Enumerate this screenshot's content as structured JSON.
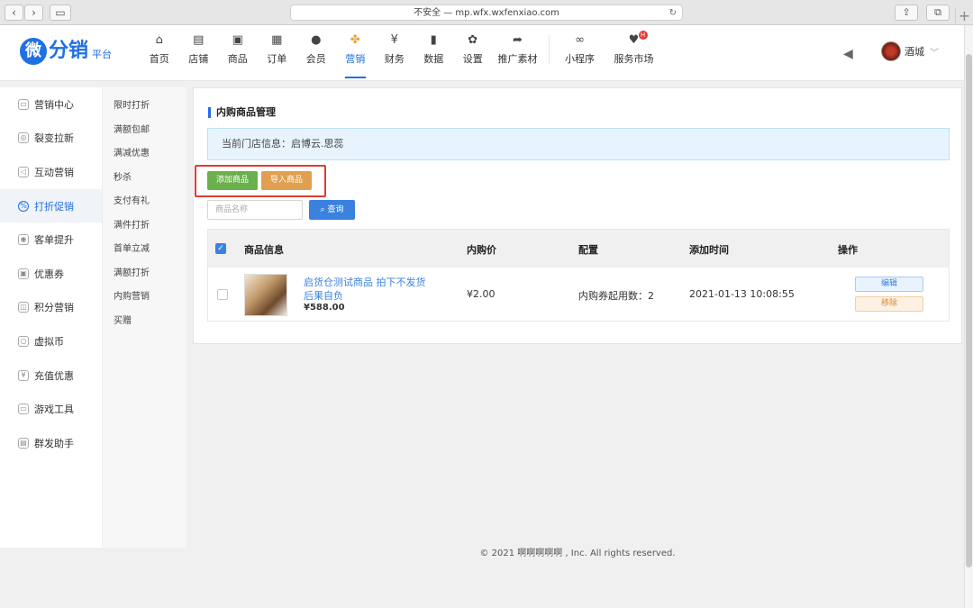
{
  "browser": {
    "url": "不安全 — mp.wfx.wxfenxiao.com",
    "back_icon": "‹",
    "forward_icon": "›",
    "reload_icon": "↻",
    "new_tab": "+"
  },
  "logo": {
    "mark": "微",
    "text": "分销",
    "sub": "平台"
  },
  "nav": [
    {
      "label": "首页",
      "icon": "⌂"
    },
    {
      "label": "店铺",
      "icon": "▤"
    },
    {
      "label": "商品",
      "icon": "▣"
    },
    {
      "label": "订单",
      "icon": "▦"
    },
    {
      "label": "会员",
      "icon": "●"
    },
    {
      "label": "营销",
      "icon": "✤"
    },
    {
      "label": "财务",
      "icon": "¥"
    },
    {
      "label": "数据",
      "icon": "▮"
    },
    {
      "label": "设置",
      "icon": "✿"
    },
    {
      "label": "推广素材",
      "icon": "➦"
    },
    {
      "label": "小程序",
      "icon": "∞"
    },
    {
      "label": "服务市场",
      "icon": "♥",
      "badge": "H"
    }
  ],
  "user": {
    "name": "酒城",
    "speaker_icon": "◀"
  },
  "side_main": [
    {
      "label": "营销中心",
      "icon": "▭"
    },
    {
      "label": "裂变拉新",
      "icon": "◎"
    },
    {
      "label": "互动营销",
      "icon": "◁"
    },
    {
      "label": "打折促销",
      "icon": "%"
    },
    {
      "label": "客单提升",
      "icon": "◉"
    },
    {
      "label": "优惠券",
      "icon": "▣"
    },
    {
      "label": "积分营销",
      "icon": "◫"
    },
    {
      "label": "虚拟币",
      "icon": "○"
    },
    {
      "label": "充值优惠",
      "icon": "¥"
    },
    {
      "label": "游戏工具",
      "icon": "▭"
    },
    {
      "label": "群发助手",
      "icon": "▤"
    }
  ],
  "side_sub": [
    "限时打折",
    "满额包邮",
    "满减优惠",
    "秒杀",
    "支付有礼",
    "满件打折",
    "首单立减",
    "满额打折",
    "内购营销",
    "买赠"
  ],
  "panel": {
    "title": "内购商品管理",
    "info": "当前门店信息：启博云.思蕊",
    "add_button": "添加商品",
    "import_button": "导入商品",
    "search_placeholder": "商品名称",
    "search_button": "查询",
    "search_icon": "⌕"
  },
  "table": {
    "headers": [
      "商品信息",
      "内购价",
      "配置",
      "添加时间",
      "操作"
    ],
    "rows": [
      {
        "name": "启货仓测试商品 拍下不发货后果自负",
        "price": "¥588.00",
        "inner_price": "¥2.00",
        "config": "内购券起用数：2",
        "time": "2021-01-13 10:08:55",
        "edit": "编辑",
        "remove": "移除"
      }
    ]
  },
  "footer": "© 2021 啊啊啊啊啊 , Inc. All rights reserved."
}
